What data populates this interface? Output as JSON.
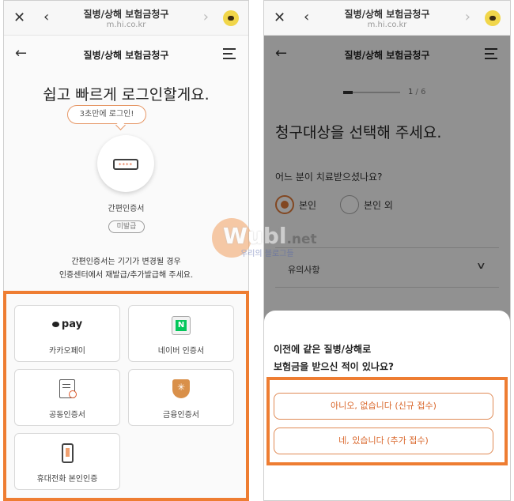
{
  "left": {
    "browser": {
      "title": "질병/상해 보험금청구",
      "url": "m.hi.co.kr"
    },
    "header": {
      "title": "질병/상해 보험금청구"
    },
    "login_title": "쉽고 빠르게 로그인할게요.",
    "bubble_text": "3초만에 로그인!",
    "cert_dots": "****",
    "cert_label": "간편인증서",
    "cert_badge": "미발급",
    "desc_line1": "간편인증서는 기기가 변경될 경우",
    "desc_line2": "인증센터에서 재발급/추가발급해 주세요.",
    "tiles": [
      {
        "label": "카카오페이",
        "icon_text": "pay"
      },
      {
        "label": "네이버 인증서",
        "icon_text": "N"
      },
      {
        "label": "공동인증서"
      },
      {
        "label": "금융인증서"
      },
      {
        "label": "휴대전화 본인인증"
      }
    ]
  },
  "right": {
    "browser": {
      "title": "질병/상해 보험금청구",
      "url": "m.hi.co.kr"
    },
    "header": {
      "title": "질병/상해 보험금청구"
    },
    "progress": {
      "current": "1",
      "sep_total": " / 6",
      "fraction": 0.1667
    },
    "title": "청구대상을 선택해 주세요.",
    "question": "어느 분이 치료받으셨나요?",
    "radio_options": [
      {
        "label": "본인",
        "selected": true
      },
      {
        "label": "본인 외",
        "selected": false
      }
    ],
    "notice_label": "유의사항",
    "sheet": {
      "question_line1": "이전에 같은 질병/상해로",
      "question_line2": "보험금을 받으신 적이 있나요?",
      "options": [
        "아니오, 없습니다 (신규 접수)",
        "네, 있습니다 (추가 접수)"
      ]
    }
  },
  "watermark": {
    "text": "Wubl",
    "suffix": ".net",
    "sub": "우리의 블로그들"
  },
  "colors": {
    "accent": "#ee7d32",
    "selected_radio": "#e07b3a",
    "naver": "#03c75a",
    "kakao_chat": "#f1d64a"
  }
}
